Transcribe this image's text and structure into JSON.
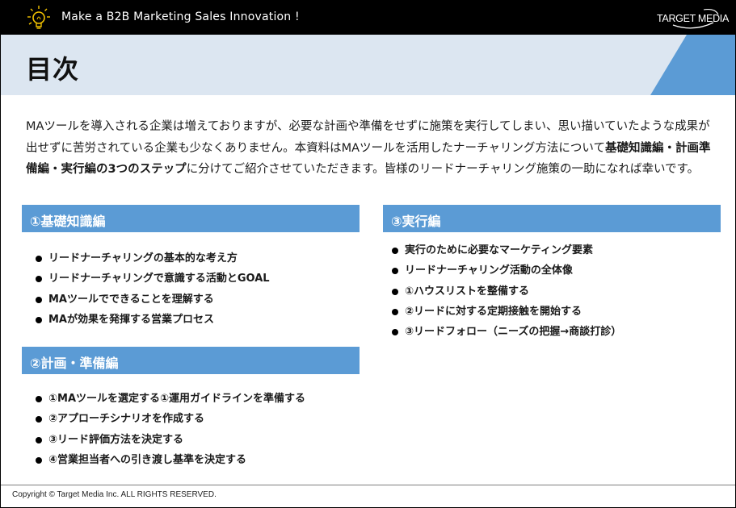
{
  "header": {
    "tagline": "Make a B2B Marketing Sales Innovation !",
    "brand": "TARGET MEDIA",
    "logo_icon": "lightbulb-icon"
  },
  "title": "目次",
  "intro": {
    "p1": "MAツールを導入される企業は増えておりますが、必要な計画や準備をせずに施策を実行してしまい、思い描いていたような成果が出せずに苦労されている企業も少なくありません。本資料はMAツールを活用したナーチャリング方法について",
    "bold1": "基礎知識編・計画準備編・実行編の3つのステップ",
    "p2": "に分けてご紹介させていただきます。皆様のリードナーチャリング施策の一助になれば幸いです。"
  },
  "sections": [
    {
      "title": "①基礎知識編",
      "items": [
        "リードナーチャリングの基本的な考え方",
        "リードナーチャリングで意識する活動とGOAL",
        "MAツールでできることを理解する",
        "MAが効果を発揮する営業プロセス"
      ]
    },
    {
      "title": "②計画・準備編",
      "items": [
        "①MAツールを選定する①運用ガイドラインを準備する",
        "②アプローチシナリオを作成する",
        "③リード評価方法を決定する",
        "④営業担当者への引き渡し基準を決定する"
      ]
    },
    {
      "title": "③実行編",
      "items": [
        "実行のために必要なマーケティング要素",
        "リードナーチャリング活動の全体像",
        "①ハウスリストを整備する",
        "②リードに対する定期接触を開始する",
        "③リードフォロー（ニーズの把握→商談打診）"
      ]
    }
  ],
  "footer": {
    "copyright": "Copyright © Target Media Inc. ALL RIGHTS RESERVED."
  },
  "colors": {
    "header_bg": "#000000",
    "title_band": "#dce6f1",
    "accent_blue": "#5b9bd5"
  }
}
